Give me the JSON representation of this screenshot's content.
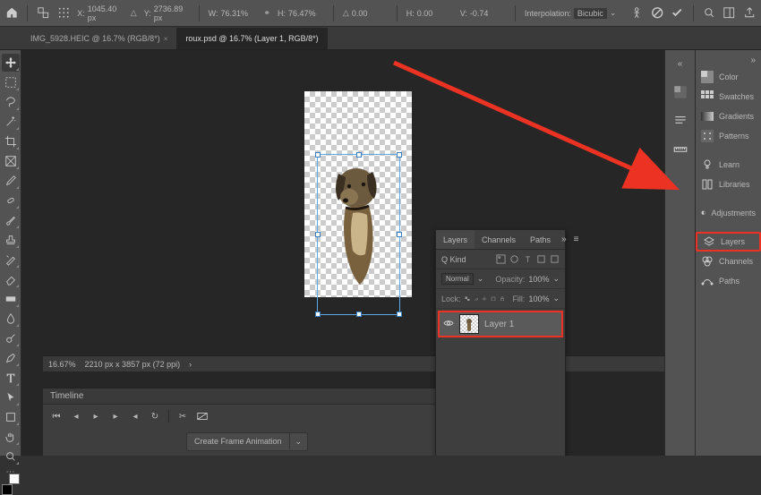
{
  "topbar": {
    "x_label": "X:",
    "x_value": "1045.40 px",
    "y_label": "Y:",
    "y_value": "2736.89 px",
    "triangle_label": "△",
    "w_label": "W:",
    "w_value": "76.31%",
    "link_icon": "⚭",
    "h_label": "H:",
    "h_value": "76.47%",
    "angle_label": "△",
    "angle_value": "0.00",
    "skew_h_label": "H:",
    "skew_h_value": "0.00",
    "skew_v_label": "V:",
    "skew_v_value": "-0.74",
    "interp_label": "Interpolation:",
    "interp_value": "Bicubic"
  },
  "tabs": [
    {
      "label": "IMG_5928.HEIC @ 16.7% (RGB/8*)",
      "active": false,
      "close": "×"
    },
    {
      "label": "roux.psd @ 16.7% (Layer 1, RGB/8*)",
      "active": true,
      "close": ""
    }
  ],
  "statusbar": {
    "zoom": "16.67%",
    "docinfo": "2210 px x 3857 px (72 ppi)"
  },
  "timeline": {
    "title": "Timeline",
    "cfa_label": "Create Frame Animation"
  },
  "layers_panel": {
    "tabs": [
      "Layers",
      "Channels",
      "Paths"
    ],
    "kind_label": "Q Kind",
    "blend": "Normal",
    "opacity_label": "Opacity:",
    "opacity_value": "100%",
    "lock_label": "Lock:",
    "fill_label": "Fill:",
    "fill_value": "100%",
    "layer1_name": "Layer 1"
  },
  "side_panels": {
    "color": "Color",
    "swatches": "Swatches",
    "gradients": "Gradients",
    "patterns": "Patterns",
    "learn": "Learn",
    "libraries": "Libraries",
    "adjustments": "Adjustments",
    "layers": "Layers",
    "channels": "Channels",
    "paths": "Paths"
  }
}
